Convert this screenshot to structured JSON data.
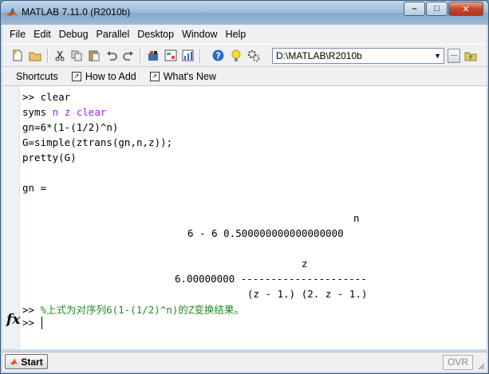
{
  "window": {
    "title": "MATLAB  7.11.0 (R2010b)",
    "minimize": "–",
    "maximize": "□",
    "close": "✕"
  },
  "menu": [
    "File",
    "Edit",
    "Debug",
    "Parallel",
    "Desktop",
    "Window",
    "Help"
  ],
  "toolbar": {
    "current_folder": "D:\\MATLAB\\R2010b",
    "browse_label": "..."
  },
  "shortcuts": {
    "label": "Shortcuts",
    "items": [
      "How to Add",
      "What's New"
    ]
  },
  "command_window": {
    "lines": {
      "l1": ">> clear",
      "l2a": "syms ",
      "l2b": "n z clear",
      "l3": "gn=6*(1-(1/2)^n)",
      "l4": "G=simple(ztrans(gn,n,z));",
      "l5": "pretty(G)",
      "l6": "gn =",
      "l7": "n",
      "l8": "6 - 6 0.500000000000000000",
      "l9": "z",
      "l10": "6.00000000 ---------------------",
      "l11": "(z - 1.) (2. z - 1.)",
      "l12a": ">> ",
      "l12b": "%上式为对序列6(1-(1/2)^n)的Z变换结果。",
      "l13": ">> "
    }
  },
  "statusbar": {
    "start": "Start",
    "ovr": "OVR"
  }
}
